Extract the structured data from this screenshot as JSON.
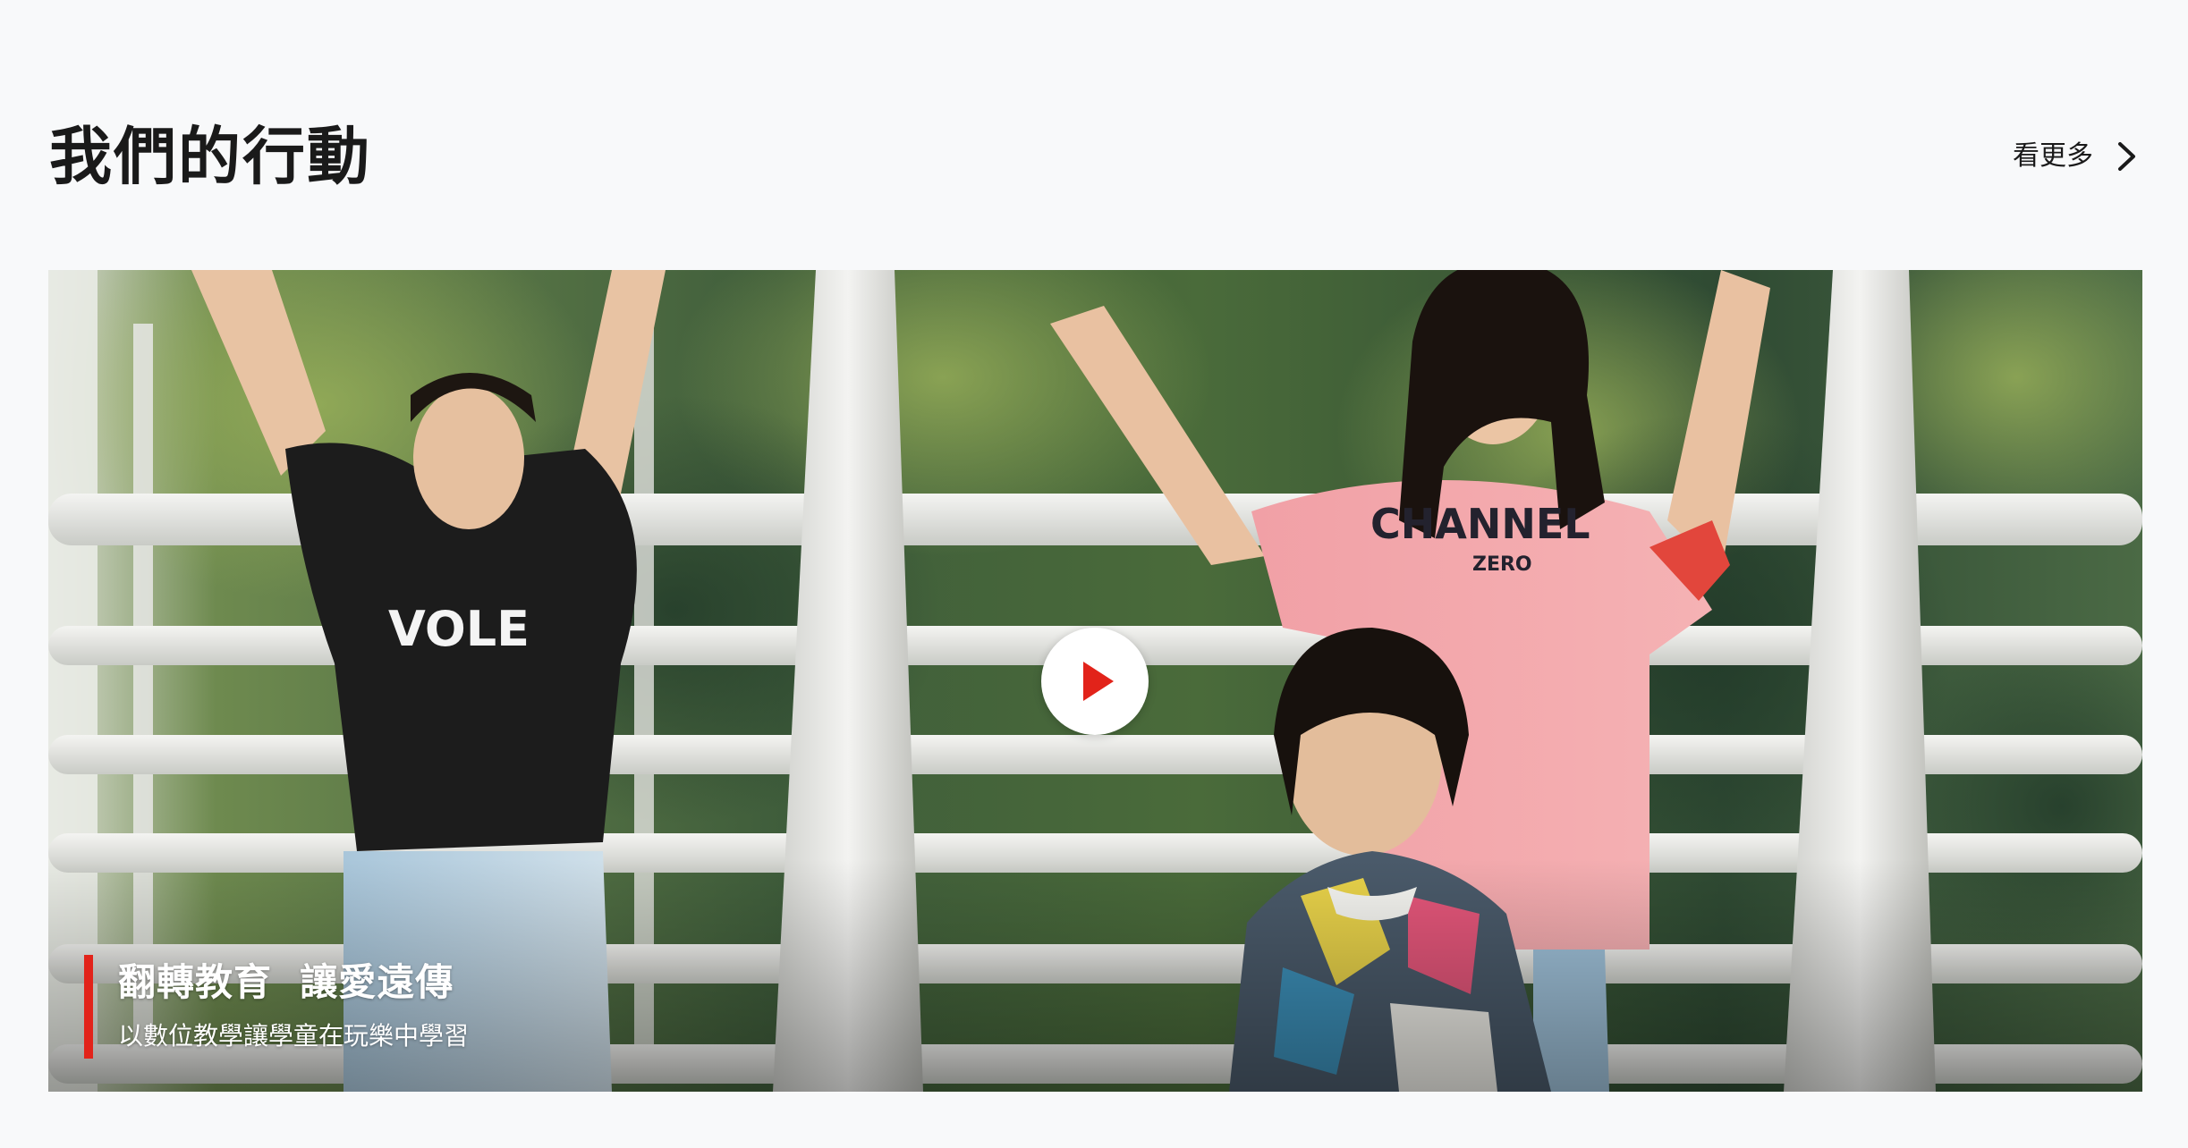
{
  "section": {
    "title": "我們的行動",
    "see_more_label": "看更多",
    "see_more_icon": "chevron-right-icon"
  },
  "video": {
    "title": "翻轉教育  讓愛遠傳",
    "subtitle": "以數位教學讓學童在玩樂中學習",
    "play_icon": "play-icon",
    "accent_color": "#e2231a",
    "shirt_text": "CHANNEL",
    "shirt_subtext": "ZERO",
    "shirt_text_left": "VOLE"
  },
  "colors": {
    "background": "#f8f9fa",
    "title_text": "#1a1a1a",
    "accent": "#e2231a"
  }
}
